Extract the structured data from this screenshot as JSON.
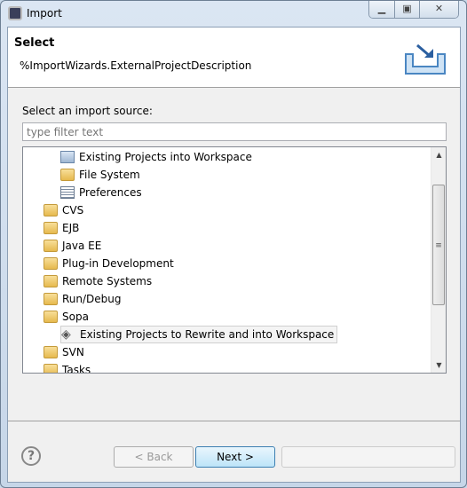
{
  "window": {
    "title": "Import",
    "icon": "eclipse-icon"
  },
  "header": {
    "title": "Select",
    "description": "%ImportWizards.ExternalProjectDescription",
    "icon": "import-wizard-icon"
  },
  "source_label": "Select an import source:",
  "filter": {
    "value": "",
    "placeholder": "type filter text"
  },
  "tree": [
    {
      "label": "Existing Projects into Workspace",
      "level": 2,
      "icon": "project-import-icon"
    },
    {
      "label": "File System",
      "level": 2,
      "icon": "folder-icon"
    },
    {
      "label": "Preferences",
      "level": 2,
      "icon": "preferences-icon"
    },
    {
      "label": "CVS",
      "level": 1,
      "icon": "folder-open-icon"
    },
    {
      "label": "EJB",
      "level": 1,
      "icon": "folder-open-icon"
    },
    {
      "label": "Java EE",
      "level": 1,
      "icon": "folder-open-icon"
    },
    {
      "label": "Plug-in Development",
      "level": 1,
      "icon": "folder-open-icon"
    },
    {
      "label": "Remote Systems",
      "level": 1,
      "icon": "folder-open-icon"
    },
    {
      "label": "Run/Debug",
      "level": 1,
      "icon": "folder-open-icon"
    },
    {
      "label": "Sopa",
      "level": 1,
      "icon": "folder-open-icon"
    },
    {
      "label": "Existing Projects to Rewrite and into Workspace",
      "level": 2,
      "icon": "sopa-wizard-icon",
      "selected": true
    },
    {
      "label": "SVN",
      "level": 1,
      "icon": "folder-open-icon"
    },
    {
      "label": "Tasks",
      "level": 1,
      "icon": "folder-open-icon"
    }
  ],
  "buttons": {
    "back": "< Back",
    "next": "Next >",
    "finish": ""
  }
}
